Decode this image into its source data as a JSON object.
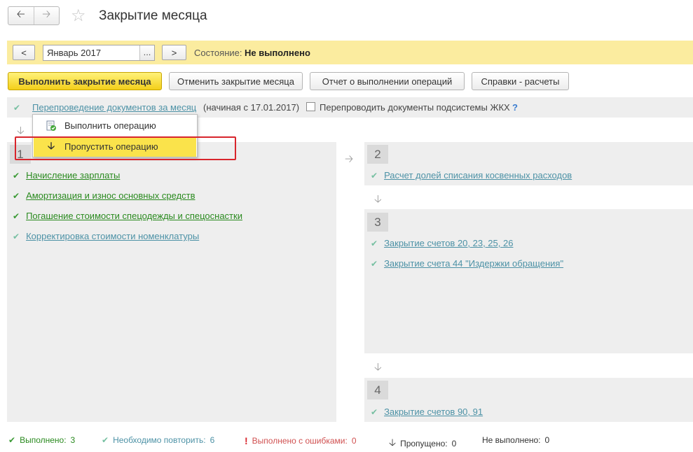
{
  "window": {
    "title": "Закрытие месяца"
  },
  "state_bar": {
    "prev_label": "<",
    "period_value": "Январь 2017",
    "period_picker_label": "...",
    "next_label": ">",
    "status_label": "Состояние:",
    "status_value": "Не выполнено"
  },
  "toolbar": {
    "run_label": "Выполнить закрытие месяца",
    "cancel_label": "Отменить закрытие месяца",
    "report_label": "Отчет о выполнении операций",
    "refs_label": "Справки - расчеты"
  },
  "reposting": {
    "link": "Перепроведение документов за месяц",
    "since": "(начиная с 17.01.2017)",
    "checkbox_label": "Перепроводить документы подсистемы ЖКХ",
    "help": "?"
  },
  "context_menu": {
    "items": [
      "Выполнить операцию",
      "Пропустить операцию"
    ]
  },
  "steps": [
    {
      "number": "1",
      "items": [
        "Начисление зарплаты",
        "Амортизация и износ основных средств",
        "Погашение стоимости спецодежды и спецоснастки",
        "Корректировка стоимости номенклатуры"
      ]
    },
    {
      "number": "2",
      "items": [
        "Расчет долей списания косвенных расходов"
      ]
    },
    {
      "number": "3",
      "items": [
        "Закрытие счетов 20, 23, 25, 26",
        "Закрытие счета 44 \"Издержки обращения\""
      ]
    },
    {
      "number": "4",
      "items": [
        "Закрытие счетов 90, 91"
      ]
    }
  ],
  "summary": {
    "done_label": "Выполнено:",
    "done_count": "3",
    "repeat_label": "Необходимо повторить:",
    "repeat_count": "6",
    "errors_label": "Выполнено с ошибками:",
    "errors_count": "0",
    "skipped_label": "Пропущено:",
    "skipped_count": "0",
    "notdone_label": "Не выполнено:",
    "notdone_count": "0"
  },
  "colors": {
    "state_bar_bg": "#fbec9f",
    "primary_button": "#f3cf1a",
    "link": "#4d92a6",
    "done_green": "#2a8a1f",
    "error_red": "#d8252c",
    "highlight_frame": "#d8252c",
    "menu_selected": "#fae34b"
  },
  "icons": {
    "back": "arrow-left-icon",
    "forward": "arrow-right-icon",
    "favorite": "star-icon",
    "check": "check-icon",
    "arrow_down": "arrow-down-icon",
    "arrow_right": "arrow-right-icon",
    "run": "run-operation-icon",
    "skip": "skip-arrow-icon",
    "error": "exclamation-icon"
  }
}
